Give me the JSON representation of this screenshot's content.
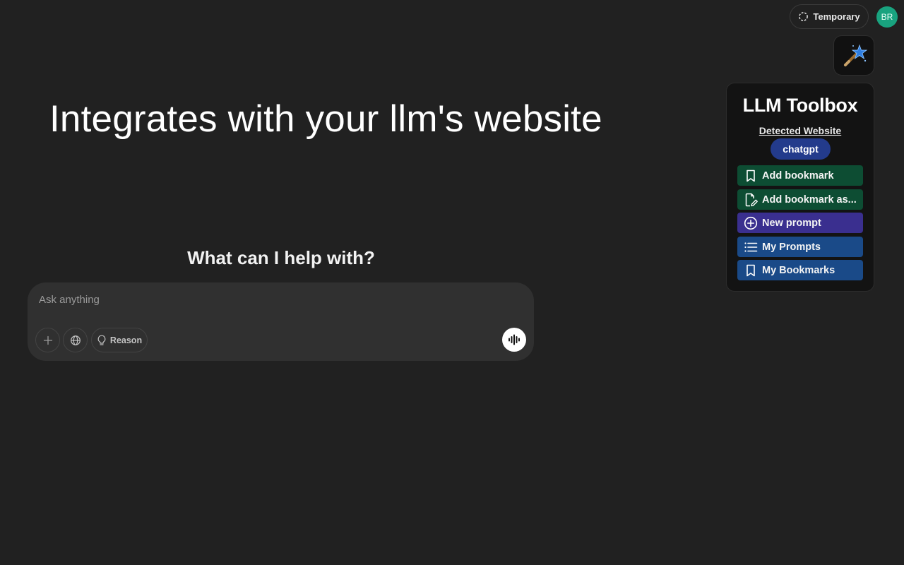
{
  "header": {
    "temporary_label": "Temporary",
    "avatar_initials": "BR"
  },
  "headline": "Integrates with your llm's website",
  "chat": {
    "title": "What can I help with?",
    "input_placeholder": "Ask anything",
    "reason_label": "Reason"
  },
  "toolbox": {
    "title": "LLM Toolbox",
    "detected_label": "Detected Website",
    "detected_site": "chatgpt",
    "buttons": [
      {
        "label": "Add bookmark",
        "icon": "bookmark-icon",
        "color": "#0d4d33"
      },
      {
        "label": "Add bookmark as...",
        "icon": "edit-document-icon",
        "color": "#0d4d33"
      },
      {
        "label": "New prompt",
        "icon": "plus-circle-icon",
        "color": "#3a2f8f"
      },
      {
        "label": "My Prompts",
        "icon": "list-icon",
        "color": "#1a4a88"
      },
      {
        "label": "My Bookmarks",
        "icon": "bookmark-icon",
        "color": "#1a4a88"
      }
    ]
  },
  "colors": {
    "background": "#212121",
    "composer": "#303030",
    "avatar": "#19a37f"
  }
}
